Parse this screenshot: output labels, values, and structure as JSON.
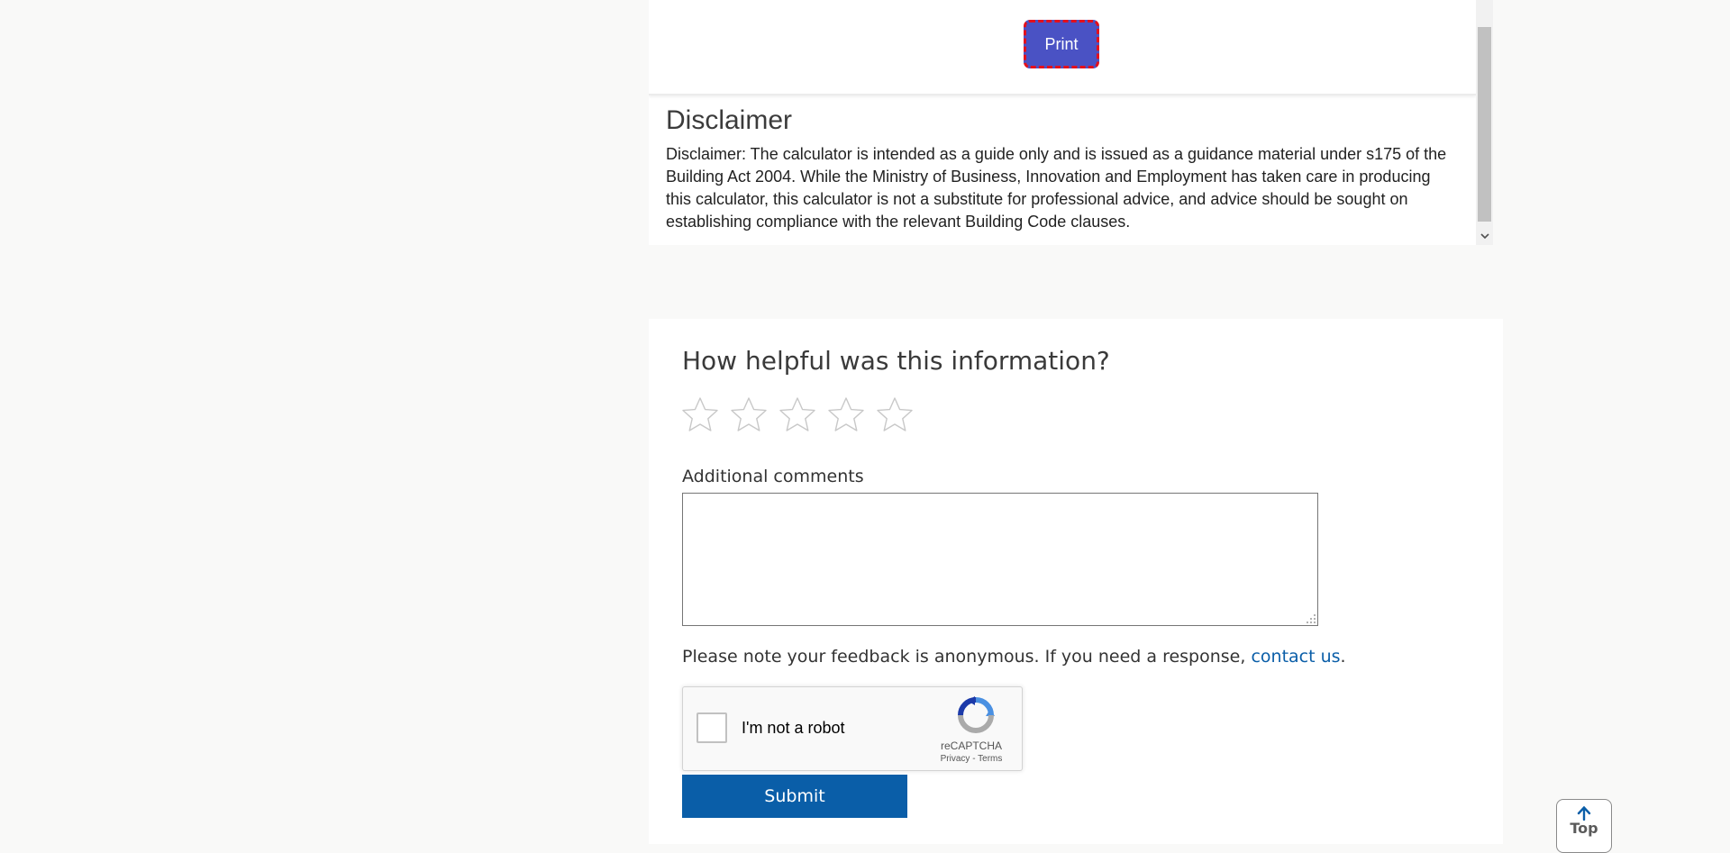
{
  "calculator": {
    "print_label": "Print",
    "disclaimer_title": "Disclaimer",
    "disclaimer_text": "Disclaimer: The calculator is intended as a guide only and is issued as a guidance material under s175 of the Building Act 2004. While the Ministry of Business, Innovation and Employment has taken care in producing this calculator, this calculator is not a substitute for professional advice, and advice should be sought on establishing compliance with the relevant Building Code clauses."
  },
  "feedback": {
    "title": "How helpful was this information?",
    "rating": {
      "selected": 0,
      "max": 5
    },
    "comments_label": "Additional comments",
    "comments_value": "",
    "note_text": "Please note your feedback is anonymous. If you need a response, ",
    "note_link": "contact us",
    "note_end": ".",
    "submit_label": "Submit"
  },
  "recaptcha": {
    "label": "I'm not a robot",
    "brand": "reCAPTCHA",
    "privacy": "Privacy",
    "separator": " - ",
    "terms": "Terms"
  },
  "top_button": {
    "label": "Top"
  },
  "colors": {
    "accent": "#0a5ea8",
    "print_bg": "#4a52c4",
    "print_border": "#e4101c",
    "page_bg": "#f9f9f8"
  },
  "icons": [
    "star-icon",
    "chevron-down-icon",
    "recaptcha-logo-icon",
    "arrow-up-icon",
    "resize-grip-icon"
  ]
}
